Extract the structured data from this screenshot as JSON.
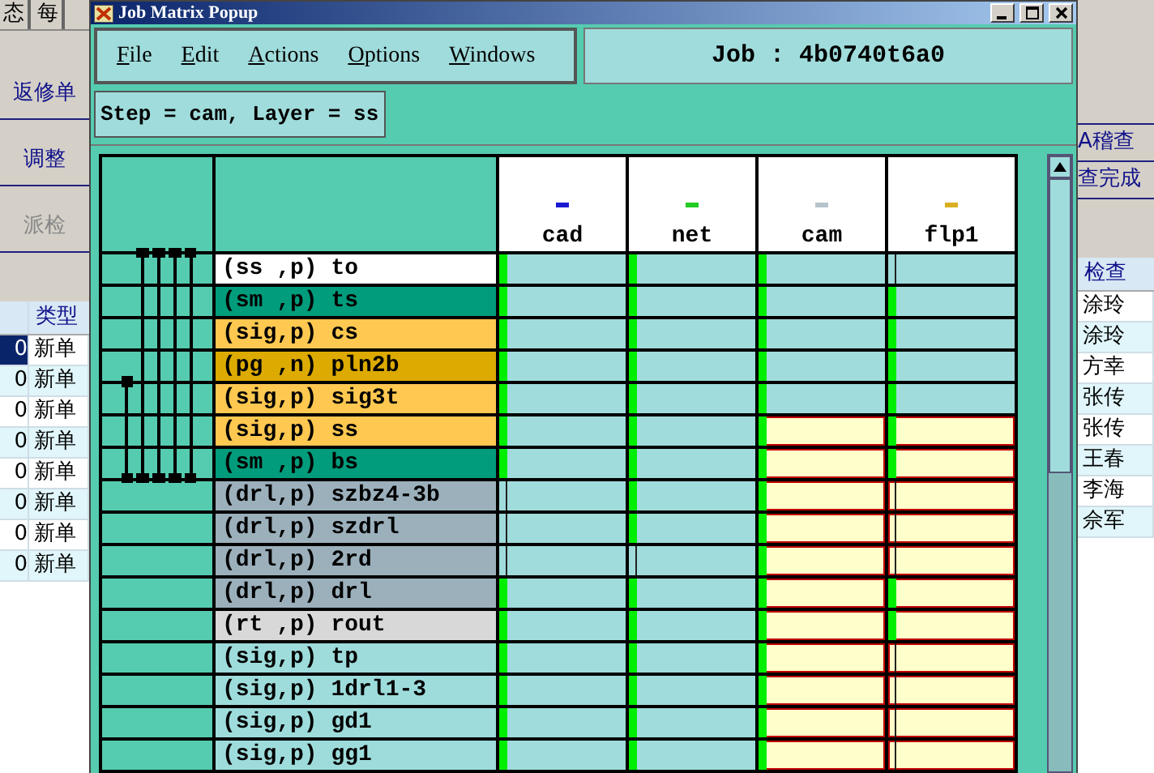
{
  "background_app": {
    "tabs": [
      "态",
      "每"
    ],
    "buttons": [
      {
        "label": "返修单",
        "disabled": false
      },
      {
        "label": "调整",
        "disabled": false
      },
      {
        "label": "派检",
        "disabled": true
      }
    ],
    "left_table": {
      "columns": [
        "类型"
      ],
      "rows": [
        {
          "column_1": "0",
          "type": "新单",
          "selected": true
        },
        {
          "column_1": "0",
          "type": "新单",
          "selected": false
        },
        {
          "column_1": "0",
          "type": "新单",
          "selected": false
        },
        {
          "column_1": "0",
          "type": "新单",
          "selected": false
        },
        {
          "column_1": "0",
          "type": "新单",
          "selected": false
        },
        {
          "column_1": "0",
          "type": "新单",
          "selected": false
        },
        {
          "column_1": "0",
          "type": "新单",
          "selected": false
        },
        {
          "column_1": "0",
          "type": "新单",
          "selected": false
        }
      ]
    },
    "right_buttons": [
      "A稽查",
      "查完成"
    ],
    "right_table": {
      "columns": [
        "检查"
      ],
      "rows": [
        "涂玲",
        "涂玲",
        "方幸",
        "张传",
        "张传",
        "王春",
        "李海",
        "佘军"
      ]
    }
  },
  "popup": {
    "title": "Job Matrix Popup",
    "menu": [
      "File",
      "Edit",
      "Actions",
      "Options",
      "Windows"
    ],
    "job_label": "Job : 4b0740t6a0",
    "status": "Step = cam, Layer = ss",
    "steps": [
      {
        "name": "cad",
        "color": "#1a1ad0"
      },
      {
        "name": "net",
        "color": "#22cc22"
      },
      {
        "name": "cam",
        "color": "#b8c4cc"
      },
      {
        "name": "flp1",
        "color": "#d8b020"
      }
    ],
    "layers": [
      {
        "label": "(ss ,p) to",
        "color": "#ffffff",
        "cells": [
          {
            "filled": true,
            "selected": false
          },
          {
            "filled": true,
            "selected": false
          },
          {
            "filled": true,
            "selected": false
          },
          {
            "filled": false,
            "selected": false
          }
        ]
      },
      {
        "label": "(sm ,p) ts",
        "color": "#009c7c",
        "cells": [
          {
            "filled": true,
            "selected": false
          },
          {
            "filled": true,
            "selected": false
          },
          {
            "filled": true,
            "selected": false
          },
          {
            "filled": true,
            "selected": false
          }
        ]
      },
      {
        "label": "(sig,p) cs",
        "color": "#ffc850",
        "cells": [
          {
            "filled": true,
            "selected": false
          },
          {
            "filled": true,
            "selected": false
          },
          {
            "filled": true,
            "selected": false
          },
          {
            "filled": true,
            "selected": false
          }
        ]
      },
      {
        "label": "(pg ,n) pln2b",
        "color": "#dcaa00",
        "cells": [
          {
            "filled": true,
            "selected": false
          },
          {
            "filled": true,
            "selected": false
          },
          {
            "filled": true,
            "selected": false
          },
          {
            "filled": true,
            "selected": false
          }
        ]
      },
      {
        "label": "(sig,p) sig3t",
        "color": "#ffc850",
        "cells": [
          {
            "filled": true,
            "selected": false
          },
          {
            "filled": true,
            "selected": false
          },
          {
            "filled": true,
            "selected": false
          },
          {
            "filled": true,
            "selected": false
          }
        ]
      },
      {
        "label": "(sig,p) ss",
        "color": "#ffc850",
        "cells": [
          {
            "filled": true,
            "selected": false
          },
          {
            "filled": true,
            "selected": false
          },
          {
            "filled": true,
            "selected": true
          },
          {
            "filled": true,
            "selected": true
          }
        ]
      },
      {
        "label": "(sm ,p) bs",
        "color": "#009c7c",
        "cells": [
          {
            "filled": true,
            "selected": false
          },
          {
            "filled": true,
            "selected": false
          },
          {
            "filled": true,
            "selected": true
          },
          {
            "filled": true,
            "selected": true
          }
        ]
      },
      {
        "label": "(drl,p) szbz4-3b",
        "color": "#9cb0bc",
        "cells": [
          {
            "filled": false,
            "selected": false
          },
          {
            "filled": true,
            "selected": false
          },
          {
            "filled": true,
            "selected": true
          },
          {
            "filled": false,
            "selected": true
          }
        ]
      },
      {
        "label": "(drl,p) szdrl",
        "color": "#9cb0bc",
        "cells": [
          {
            "filled": false,
            "selected": false
          },
          {
            "filled": true,
            "selected": false
          },
          {
            "filled": true,
            "selected": true
          },
          {
            "filled": false,
            "selected": true
          }
        ]
      },
      {
        "label": "(drl,p) 2rd",
        "color": "#9cb0bc",
        "cells": [
          {
            "filled": false,
            "selected": false
          },
          {
            "filled": false,
            "selected": false
          },
          {
            "filled": true,
            "selected": true
          },
          {
            "filled": false,
            "selected": true
          }
        ]
      },
      {
        "label": "(drl,p) drl",
        "color": "#9cb0bc",
        "cells": [
          {
            "filled": true,
            "selected": false
          },
          {
            "filled": true,
            "selected": false
          },
          {
            "filled": true,
            "selected": true
          },
          {
            "filled": true,
            "selected": true
          }
        ]
      },
      {
        "label": "(rt ,p) rout",
        "color": "#d8d8d8",
        "cells": [
          {
            "filled": true,
            "selected": false
          },
          {
            "filled": true,
            "selected": false
          },
          {
            "filled": true,
            "selected": true
          },
          {
            "filled": true,
            "selected": true
          }
        ]
      },
      {
        "label": "(sig,p) tp",
        "color": "#9edcdc",
        "cells": [
          {
            "filled": true,
            "selected": false
          },
          {
            "filled": true,
            "selected": false
          },
          {
            "filled": true,
            "selected": true
          },
          {
            "filled": false,
            "selected": true
          }
        ]
      },
      {
        "label": "(sig,p) 1drl1-3",
        "color": "#9edcdc",
        "cells": [
          {
            "filled": true,
            "selected": false
          },
          {
            "filled": true,
            "selected": false
          },
          {
            "filled": true,
            "selected": true
          },
          {
            "filled": false,
            "selected": true
          }
        ]
      },
      {
        "label": "(sig,p) gd1",
        "color": "#9edcdc",
        "cells": [
          {
            "filled": true,
            "selected": false
          },
          {
            "filled": true,
            "selected": false
          },
          {
            "filled": true,
            "selected": true
          },
          {
            "filled": false,
            "selected": true
          }
        ]
      },
      {
        "label": "(sig,p) gg1",
        "color": "#9edcdc",
        "cells": [
          {
            "filled": true,
            "selected": false
          },
          {
            "filled": true,
            "selected": false
          },
          {
            "filled": true,
            "selected": true
          },
          {
            "filled": false,
            "selected": true
          }
        ]
      }
    ]
  }
}
